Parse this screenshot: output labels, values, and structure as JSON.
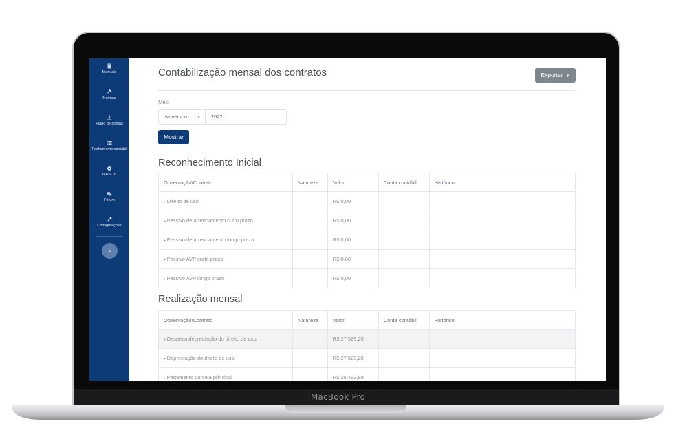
{
  "device": {
    "brand": "MacBook Pro"
  },
  "sidebar": {
    "items": [
      {
        "label": "Manuais",
        "icon": "book-icon"
      },
      {
        "label": "Normas",
        "icon": "gavel-icon"
      },
      {
        "label": "Plano de contas",
        "icon": "download-icon"
      },
      {
        "label": "Fechamento contábil",
        "icon": "list-icon"
      },
      {
        "label": "IFRS 16",
        "icon": "gear-icon"
      },
      {
        "label": "Fórum",
        "icon": "chat-icon"
      },
      {
        "label": "Configurações",
        "icon": "wrench-icon"
      }
    ],
    "collapse_glyph": "›"
  },
  "header": {
    "title": "Contabilização mensal dos contratos",
    "export_label": "Exportar"
  },
  "filter": {
    "month_label": "Mês:",
    "month_value": "Novembro",
    "year_value": "2022",
    "show_label": "Mostrar"
  },
  "table_headers": [
    "Observação\\Contrato",
    "Natureza",
    "Valor",
    "Conta contábil",
    "Histórico"
  ],
  "reconhecimento": {
    "title": "Reconhecimento Inicial",
    "rows": [
      {
        "obs": "Direito de uso",
        "valor": "R$ 0,00"
      },
      {
        "obs": "Passivo de arrendamento curto prazo",
        "valor": "R$ 0,00"
      },
      {
        "obs": "Passivo de arrendamento longo prazo",
        "valor": "R$ 0,00"
      },
      {
        "obs": "Passivo AVP curto prazo",
        "valor": "R$ 0,00"
      },
      {
        "obs": "Passivo AVP longo prazo",
        "valor": "R$ 0,00"
      }
    ]
  },
  "realizacao": {
    "title": "Realização mensal",
    "rows": [
      {
        "obs": "Despesa depreciação do direito de uso",
        "valor": "R$ 27.529,20"
      },
      {
        "obs": "Depreciação do direto de uso",
        "valor": "R$ 27.529,20"
      },
      {
        "obs": "Pagamento parcela principal",
        "valor": "R$ 25.493,89"
      }
    ]
  },
  "colors": {
    "sidebar": "#0d3b78",
    "primary_button": "#0d3b78",
    "export_button": "#7f868d"
  }
}
